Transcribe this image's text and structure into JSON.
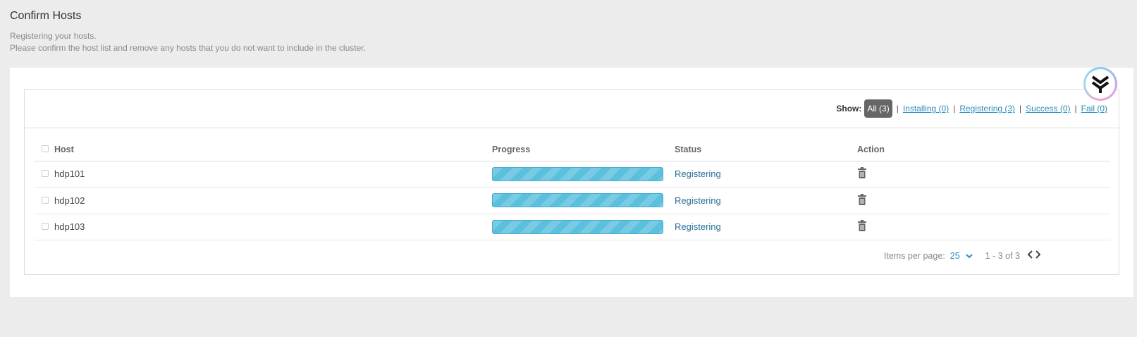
{
  "header": {
    "title": "Confirm Hosts",
    "subtitle_line1": "Registering your hosts.",
    "subtitle_line2": "Please confirm the host list and remove any hosts that you do not want to include in the cluster."
  },
  "filters": {
    "show_label": "Show:",
    "all": "All (3)",
    "installing": "Installing (0)",
    "registering": "Registering (3)",
    "success": "Success (0)",
    "fail": "Fail (0)",
    "separator": "|"
  },
  "table": {
    "columns": [
      "Host",
      "Progress",
      "Status",
      "Action"
    ],
    "rows": [
      {
        "host": "hdp101",
        "progress": 1.0,
        "status": "Registering"
      },
      {
        "host": "hdp102",
        "progress": 1.0,
        "status": "Registering"
      },
      {
        "host": "hdp103",
        "progress": 1.0,
        "status": "Registering"
      }
    ]
  },
  "pager": {
    "items_per_page_label": "Items per page:",
    "items_per_page_value": "25",
    "range": "1 - 3 of 3"
  },
  "colors": {
    "progress": "#5bc0de",
    "link": "#2a8fbd",
    "status": "#2b6f99",
    "active_pill": "#666666"
  },
  "icons": {
    "row_action": "trash-icon",
    "badge": "logo-icon"
  }
}
